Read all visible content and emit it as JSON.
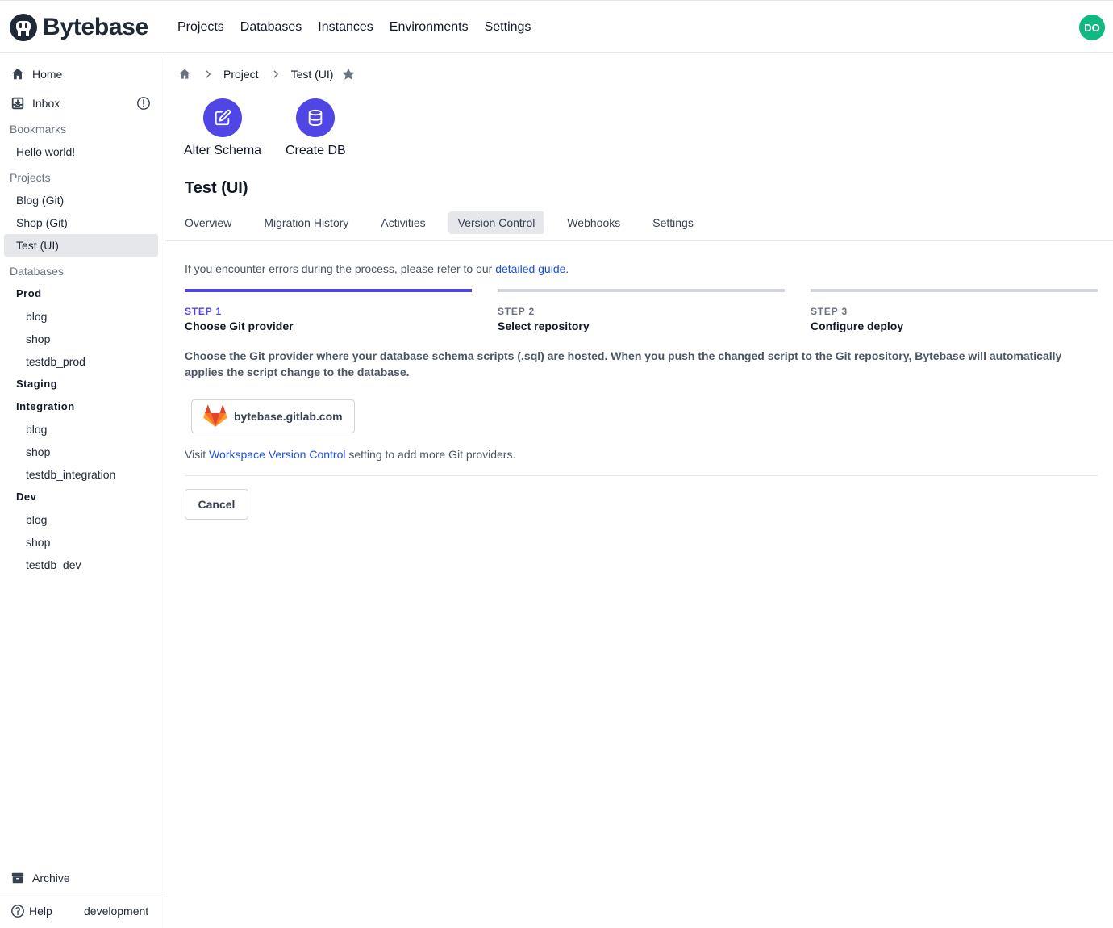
{
  "app": {
    "name": "Bytebase",
    "nav": [
      "Projects",
      "Databases",
      "Instances",
      "Environments",
      "Settings"
    ],
    "user_initials": "DO",
    "user_avatar_color": "#10b981"
  },
  "sidebar": {
    "home": "Home",
    "inbox": "Inbox",
    "bookmarks_header": "Bookmarks",
    "bookmarks": [
      "Hello world!"
    ],
    "projects_header": "Projects",
    "projects": [
      "Blog (Git)",
      "Shop (Git)",
      "Test (UI)"
    ],
    "selected_project": "Test (UI)",
    "databases_header": "Databases",
    "environments": [
      {
        "name": "Prod",
        "databases": [
          "blog",
          "shop",
          "testdb_prod"
        ]
      },
      {
        "name": "Staging",
        "databases": []
      },
      {
        "name": "Integration",
        "databases": [
          "blog",
          "shop",
          "testdb_integration"
        ]
      },
      {
        "name": "Dev",
        "databases": [
          "blog",
          "shop",
          "testdb_dev"
        ]
      }
    ],
    "archive": "Archive",
    "help": "Help",
    "mode": "development"
  },
  "breadcrumb": {
    "project": "Project",
    "current": "Test (UI)"
  },
  "quick_actions": {
    "alter_schema": "Alter Schema",
    "create_db": "Create DB"
  },
  "page": {
    "title": "Test (UI)",
    "tabs": [
      "Overview",
      "Migration History",
      "Activities",
      "Version Control",
      "Webhooks",
      "Settings"
    ],
    "active_tab": "Version Control"
  },
  "vcs": {
    "notice_prefix": "If you encounter errors during the process, please refer to our ",
    "notice_link": "detailed guide",
    "notice_suffix": ".",
    "steps": [
      {
        "number": "STEP 1",
        "title": "Choose Git provider"
      },
      {
        "number": "STEP 2",
        "title": "Select repository"
      },
      {
        "number": "STEP 3",
        "title": "Configure deploy"
      }
    ],
    "active_step": 1,
    "description": "Choose the Git provider where your database schema scripts (.sql) are hosted. When you push the changed script to the Git repository, Bytebase will automatically applies the script change to the database.",
    "provider": "bytebase.gitlab.com",
    "visit_prefix": "Visit ",
    "visit_link": "Workspace Version Control",
    "visit_suffix": " setting to add more Git providers.",
    "cancel": "Cancel"
  },
  "colors": {
    "accent": "#4f46e5",
    "link": "#1d4ed8",
    "selected_bg": "#e5e7eb"
  }
}
